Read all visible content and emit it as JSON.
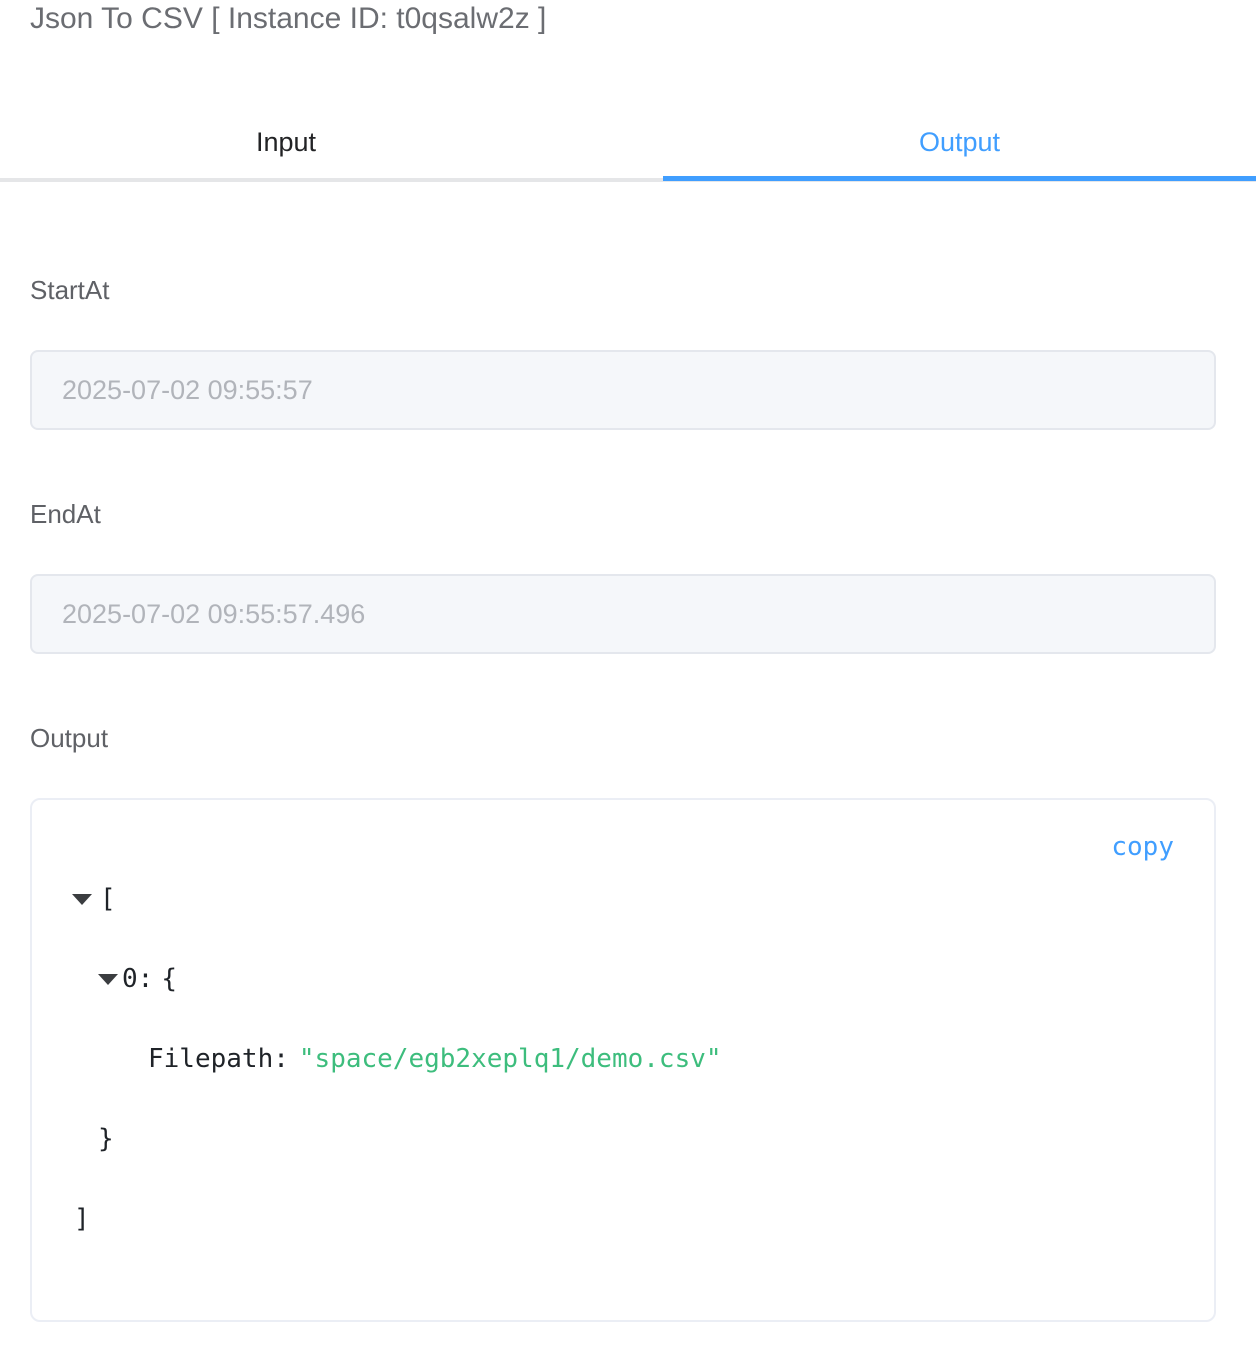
{
  "dialog": {
    "title": "Json To CSV [ Instance ID: t0qsalw2z ]"
  },
  "tabs": [
    {
      "label": "Input",
      "active": false
    },
    {
      "label": "Output",
      "active": true
    }
  ],
  "fields": {
    "start_at": {
      "label": "StartAt",
      "value": "2025-07-02 09:55:57"
    },
    "end_at": {
      "label": "EndAt",
      "value": "2025-07-02 09:55:57.496"
    },
    "output": {
      "label": "Output"
    }
  },
  "json_viewer": {
    "copy_label": "copy",
    "open_bracket": "[",
    "item_index": "0:",
    "item_open_brace": "{",
    "entry_key": "Filepath:",
    "entry_value": "\"space/egb2xeplq1/demo.csv\"",
    "item_close_brace": "}",
    "close_bracket": "]"
  },
  "colors": {
    "accent": "#409eff",
    "string_value": "#3dbd7d",
    "disabled_bg": "#f5f7fa"
  }
}
